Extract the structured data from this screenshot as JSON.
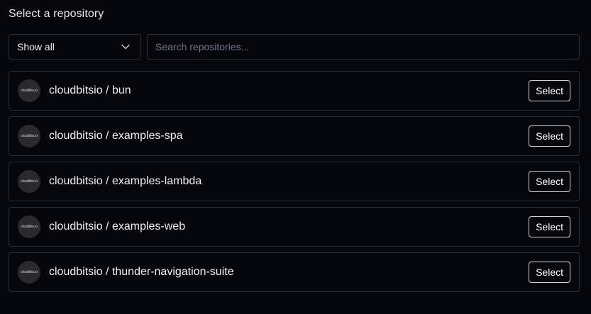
{
  "heading": "Select a repository",
  "filter": {
    "selected": "Show all",
    "icon": "chevron-down-icon"
  },
  "search": {
    "placeholder": "Search repositories...",
    "value": ""
  },
  "repositories": [
    {
      "name": "cloudbitsio / bun",
      "avatar_text": "cloudbits.io",
      "action": "Select"
    },
    {
      "name": "cloudbitsio / examples-spa",
      "avatar_text": "cloudbits.io",
      "action": "Select"
    },
    {
      "name": "cloudbitsio / examples-lambda",
      "avatar_text": "cloudbits.io",
      "action": "Select"
    },
    {
      "name": "cloudbitsio / examples-web",
      "avatar_text": "cloudbits.io",
      "action": "Select"
    },
    {
      "name": "cloudbitsio / thunder-navigation-suite",
      "avatar_text": "cloudbits.io",
      "action": "Select"
    }
  ],
  "colors": {
    "background": "#05070d",
    "border": "#2a2f38",
    "avatar_accent": "#e0573a"
  }
}
